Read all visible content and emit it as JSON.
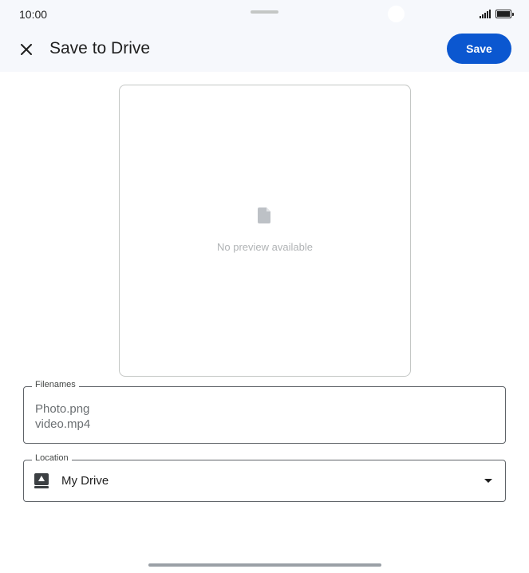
{
  "status_bar": {
    "time": "10:00"
  },
  "header": {
    "close_icon": "close-icon",
    "title": "Save to Drive",
    "save_label": "Save"
  },
  "preview": {
    "icon": "file-icon",
    "message": "No preview available"
  },
  "filenames": {
    "label": "Filenames",
    "values": [
      "Photo.png",
      "video.mp4"
    ]
  },
  "location": {
    "label": "Location",
    "icon": "drive-icon",
    "value": "My Drive"
  },
  "colors": {
    "accent": "#0b57d0",
    "header_bg": "#f6f8fc"
  }
}
